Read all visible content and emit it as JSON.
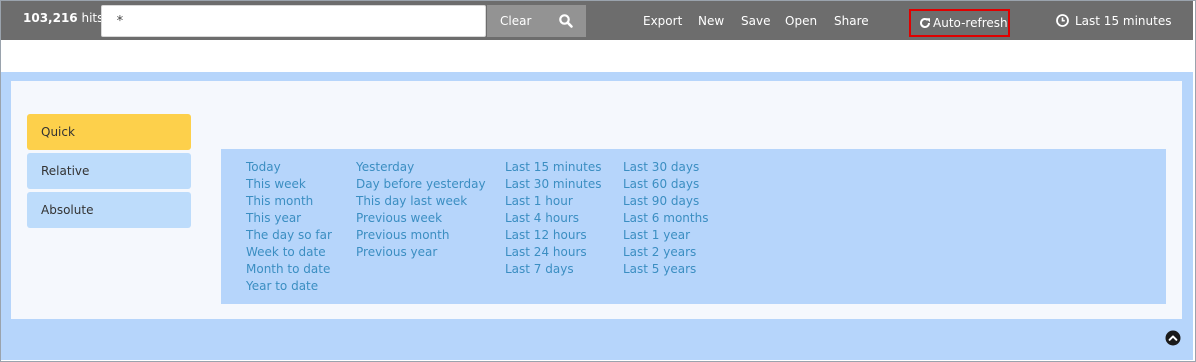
{
  "header": {
    "hits_count": "103,216",
    "hits_label": "hits",
    "query_value": "*",
    "clear_label": "Clear",
    "nav": {
      "export": "Export",
      "new": "New",
      "save": "Save",
      "open": "Open",
      "share": "Share"
    },
    "auto_refresh": "Auto-refresh",
    "time_range": "Last 15 minutes",
    "icons": {
      "search": "search-icon",
      "refresh": "refresh-icon",
      "clock": "clock-icon"
    }
  },
  "picker": {
    "tabs": [
      "Quick",
      "Relative",
      "Absolute"
    ],
    "active_tab": "Quick",
    "quick": {
      "col1": [
        "Today",
        "This week",
        "This month",
        "This year",
        "The day so far",
        "Week to date",
        "Month to date",
        "Year to date"
      ],
      "col2": [
        "Yesterday",
        "Day before yesterday",
        "This day last week",
        "Previous week",
        "Previous month",
        "Previous year"
      ],
      "col3": [
        "Last 15 minutes",
        "Last 30 minutes",
        "Last 1 hour",
        "Last 4 hours",
        "Last 12 hours",
        "Last 24 hours",
        "Last 7 days"
      ],
      "col4": [
        "Last 30 days",
        "Last 60 days",
        "Last 90 days",
        "Last 6 months",
        "Last 1 year",
        "Last 2 years",
        "Last 5 years"
      ]
    },
    "collapse_icon": "chevron-up-circle-icon"
  },
  "colors": {
    "topbar": "#6d6d6d",
    "accent_active": "#fdd04b",
    "panel_blue": "#b6d5fb",
    "link_blue": "#3b8ec2",
    "highlight_red": "#e00000"
  }
}
